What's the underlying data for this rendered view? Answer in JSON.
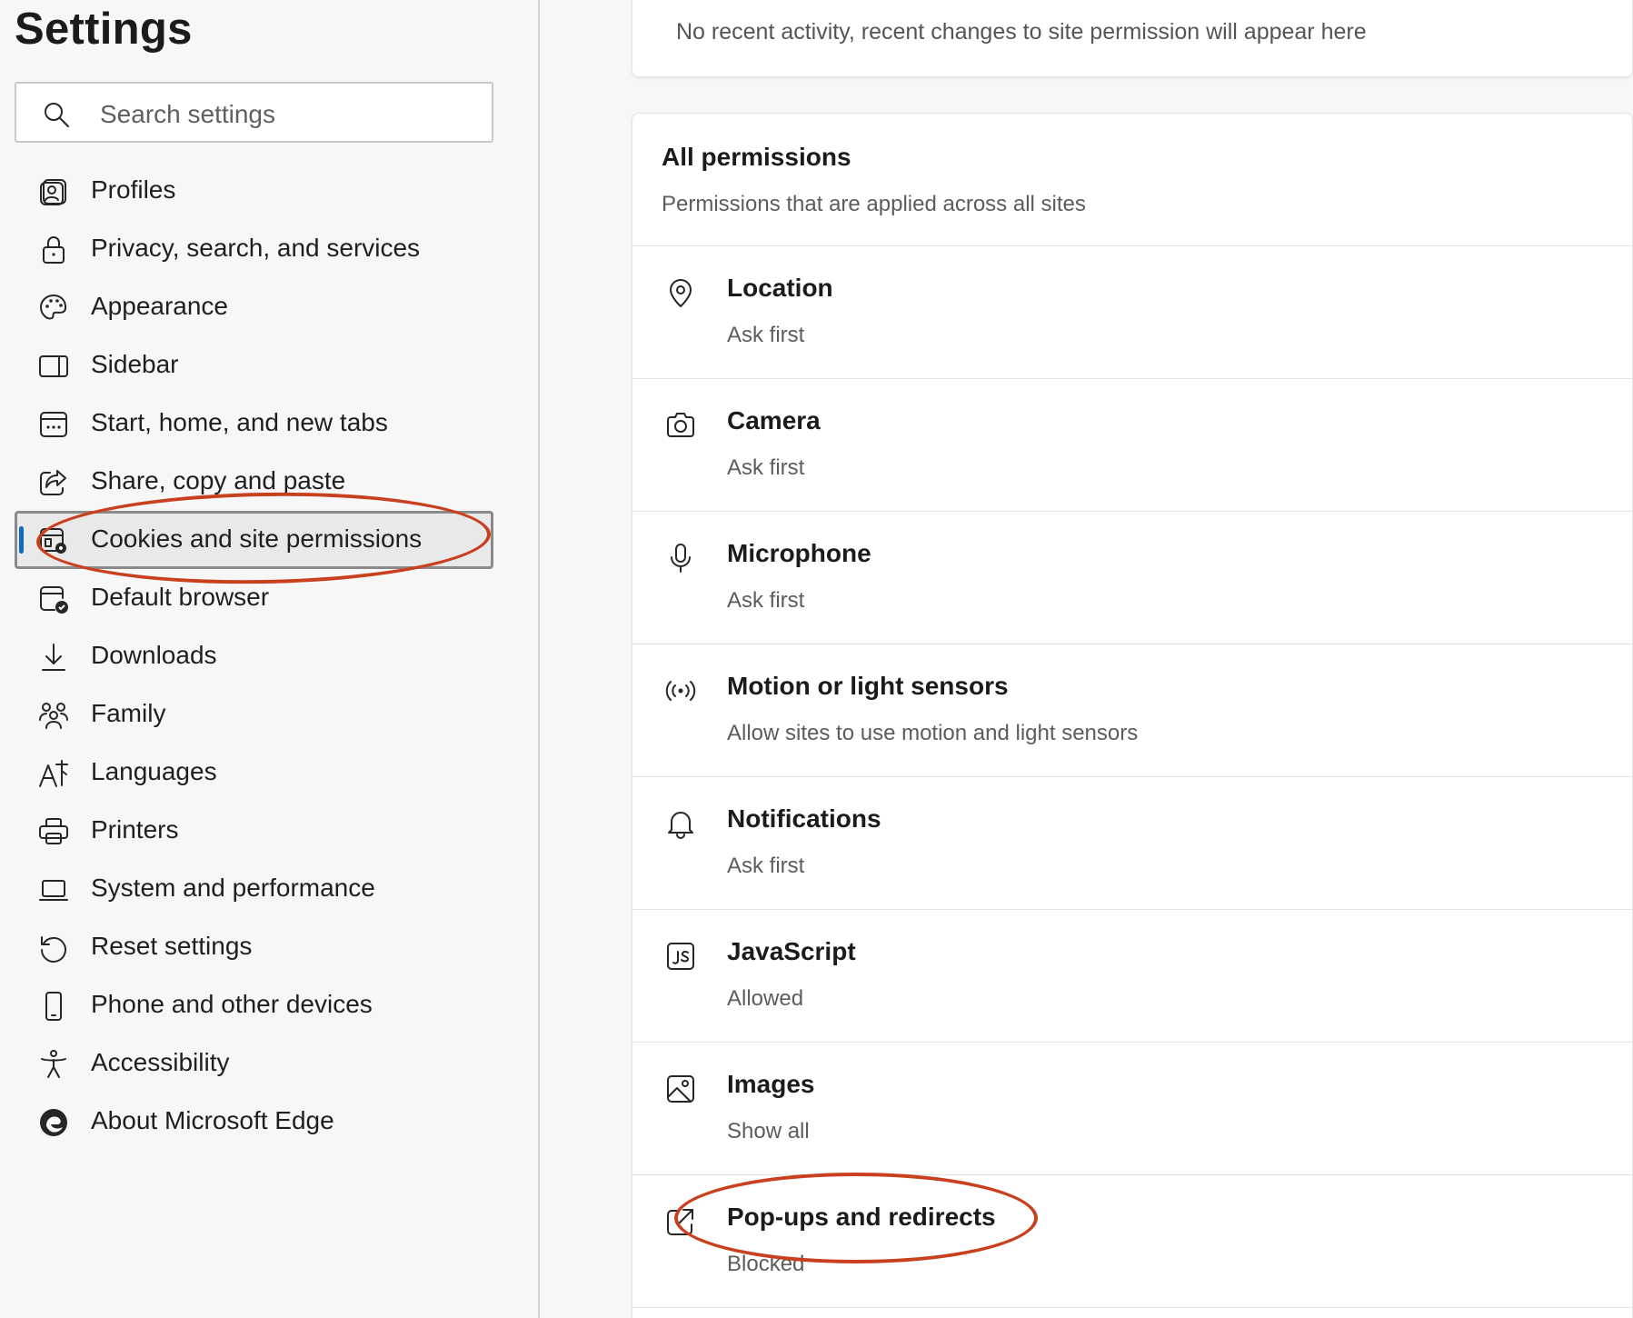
{
  "sidebar": {
    "title": "Settings",
    "search_placeholder": "Search settings",
    "items": [
      {
        "label": "Profiles",
        "icon": "profile-icon"
      },
      {
        "label": "Privacy, search, and services",
        "icon": "lock-icon"
      },
      {
        "label": "Appearance",
        "icon": "palette-icon"
      },
      {
        "label": "Sidebar",
        "icon": "sidebar-icon"
      },
      {
        "label": "Start, home, and new tabs",
        "icon": "home-tabs-icon"
      },
      {
        "label": "Share, copy and paste",
        "icon": "share-icon"
      },
      {
        "label": "Cookies and site permissions",
        "icon": "cookies-permissions-icon",
        "active": true
      },
      {
        "label": "Default browser",
        "icon": "default-browser-icon"
      },
      {
        "label": "Downloads",
        "icon": "download-icon"
      },
      {
        "label": "Family",
        "icon": "family-icon"
      },
      {
        "label": "Languages",
        "icon": "languages-icon"
      },
      {
        "label": "Printers",
        "icon": "printer-icon"
      },
      {
        "label": "System and performance",
        "icon": "laptop-icon"
      },
      {
        "label": "Reset settings",
        "icon": "reset-icon"
      },
      {
        "label": "Phone and other devices",
        "icon": "phone-icon"
      },
      {
        "label": "Accessibility",
        "icon": "accessibility-icon"
      },
      {
        "label": "About Microsoft Edge",
        "icon": "edge-logo-icon"
      }
    ]
  },
  "main": {
    "recent_activity_text": "No recent activity, recent changes to site permission will appear here",
    "all_permissions": {
      "heading": "All permissions",
      "subheading": "Permissions that are applied across all sites",
      "items": [
        {
          "name": "Location",
          "value": "Ask first",
          "icon": "location-icon"
        },
        {
          "name": "Camera",
          "value": "Ask first",
          "icon": "camera-icon"
        },
        {
          "name": "Microphone",
          "value": "Ask first",
          "icon": "microphone-icon"
        },
        {
          "name": "Motion or light sensors",
          "value": "Allow sites to use motion and light sensors",
          "icon": "sensor-icon"
        },
        {
          "name": "Notifications",
          "value": "Ask first",
          "icon": "bell-icon"
        },
        {
          "name": "JavaScript",
          "value": "Allowed",
          "icon": "javascript-icon"
        },
        {
          "name": "Images",
          "value": "Show all",
          "icon": "image-icon"
        },
        {
          "name": "Pop-ups and redirects",
          "value": "Blocked",
          "icon": "popup-icon"
        }
      ]
    }
  },
  "colors": {
    "accent": "#0f6cbd",
    "annotation": "#c8401e",
    "background": "#f7f7f7"
  }
}
